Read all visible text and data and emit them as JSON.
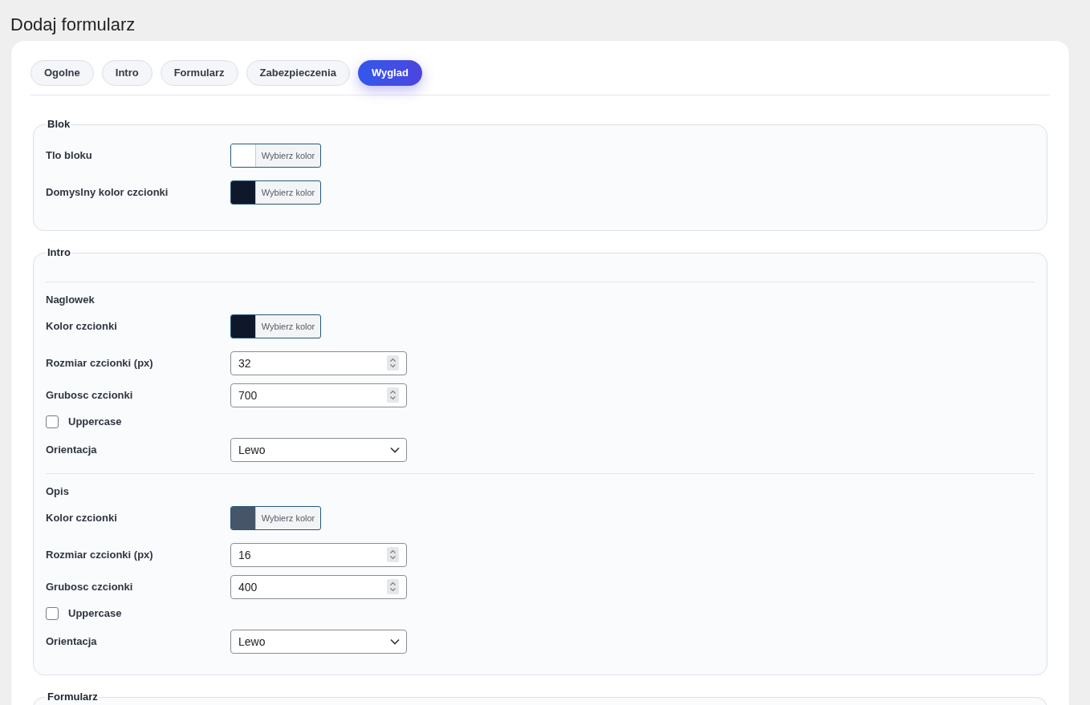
{
  "page": {
    "title": "Dodaj formularz"
  },
  "tabs": [
    {
      "label": "Ogolne",
      "selected": false
    },
    {
      "label": "Intro",
      "selected": false
    },
    {
      "label": "Formularz",
      "selected": false
    },
    {
      "label": "Zabezpieczenia",
      "selected": false
    },
    {
      "label": "Wyglad",
      "selected": true
    }
  ],
  "sections": [
    {
      "legend": "Blok",
      "rows": [
        {
          "kind": "color",
          "label": "Tlo bloku",
          "color": "#ffffff",
          "button": "Wybierz kolor"
        },
        {
          "kind": "color",
          "label": "Domyslny kolor czcionki",
          "color": "#0f172a",
          "button": "Wybierz kolor"
        }
      ]
    },
    {
      "legend": "Intro",
      "groups": [
        {
          "heading": "Naglowek",
          "rows": [
            {
              "kind": "color",
              "label": "Kolor czcionki",
              "color": "#0f172a",
              "button": "Wybierz kolor"
            },
            {
              "kind": "number",
              "label": "Rozmiar czcionki (px)",
              "value": "32"
            },
            {
              "kind": "number",
              "label": "Grubosc czcionki",
              "value": "700"
            },
            {
              "kind": "checkbox",
              "label": "Uppercase",
              "checked": false
            },
            {
              "kind": "select",
              "label": "Orientacja",
              "value": "Lewo"
            }
          ]
        },
        {
          "heading": "Opis",
          "rows": [
            {
              "kind": "color",
              "label": "Kolor czcionki",
              "color": "#475569",
              "button": "Wybierz kolor"
            },
            {
              "kind": "number",
              "label": "Rozmiar czcionki (px)",
              "value": "16"
            },
            {
              "kind": "number",
              "label": "Grubosc czcionki",
              "value": "400"
            },
            {
              "kind": "checkbox",
              "label": "Uppercase",
              "checked": false
            },
            {
              "kind": "select",
              "label": "Orientacja",
              "value": "Lewo"
            }
          ]
        }
      ]
    },
    {
      "legend": "Formularz"
    }
  ]
}
